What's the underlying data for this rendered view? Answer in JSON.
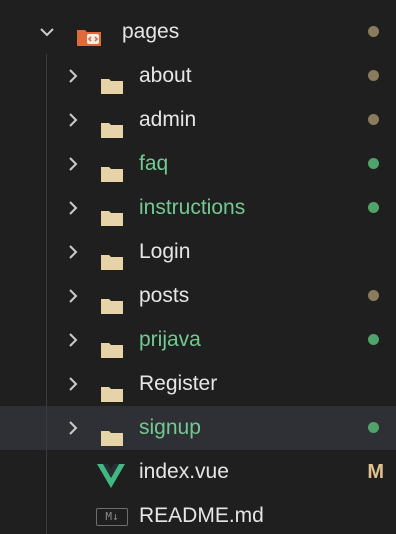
{
  "colors": {
    "background": "#1f1f1f",
    "selected_row": "#2f3036",
    "text_default": "#e6e6e6",
    "text_untracked": "#73c991",
    "dot_modified": "#8a7a5e",
    "dot_untracked": "#4fa36b",
    "status_m": "#e2c08d",
    "folder_icon": "#e6d3a8",
    "vue_green": "#41b883",
    "vue_dark": "#35495e",
    "pages_folder": "#e06a3c"
  },
  "root": {
    "label": "pages",
    "icon": "pages-folder-icon",
    "chevron": "chevron-down-icon"
  },
  "items": [
    {
      "label": "about",
      "icon": "folder-icon",
      "status": "modified"
    },
    {
      "label": "admin",
      "icon": "folder-icon",
      "status": "modified"
    },
    {
      "label": "faq",
      "icon": "folder-icon",
      "status": "untracked"
    },
    {
      "label": "instructions",
      "icon": "folder-icon",
      "status": "untracked"
    },
    {
      "label": "Login",
      "icon": "folder-icon",
      "status": ""
    },
    {
      "label": "posts",
      "icon": "folder-icon",
      "status": "modified"
    },
    {
      "label": "prijava",
      "icon": "folder-icon",
      "status": "untracked"
    },
    {
      "label": "Register",
      "icon": "folder-icon",
      "status": ""
    },
    {
      "label": "signup",
      "icon": "folder-icon",
      "status": "untracked",
      "selected": true
    }
  ],
  "files": [
    {
      "label": "index.vue",
      "icon": "vue-icon",
      "status_letter": "M"
    },
    {
      "label": "README.md",
      "icon": "markdown-icon",
      "status_letter": ""
    }
  ],
  "markdown_icon_text": "M↓"
}
